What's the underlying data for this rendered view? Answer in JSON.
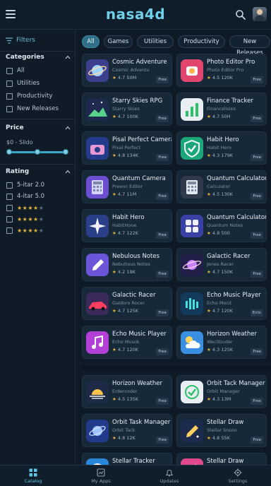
{
  "header": {
    "brand": "nasa4d",
    "menu_icon": "hamburger-icon",
    "search_icon": "search-icon"
  },
  "sidebar": {
    "filters_label": "Filters",
    "categories": {
      "title": "Categories",
      "items": [
        "All",
        "Utilities",
        "Productivity",
        "New Releases"
      ]
    },
    "price": {
      "title": "Price",
      "range_label": "$0 - Slido",
      "range": [
        0,
        1
      ]
    },
    "rating": {
      "title": "Rating",
      "items": [
        {
          "label": "5-itar 2.0",
          "stars": 0
        },
        {
          "label": "4-itar 5.0",
          "stars": 0
        },
        {
          "label": "",
          "stars": 4
        },
        {
          "label": "",
          "stars": 4
        },
        {
          "label": "",
          "stars": 4
        }
      ]
    }
  },
  "chips": [
    "All",
    "Games",
    "Utilities",
    "Productivity",
    "New Releases"
  ],
  "apps": [
    {
      "name": "Cosmic Adventure",
      "sub": "Cosmic Adventu",
      "rating": "4.7",
      "count": "50M",
      "badge": "Free",
      "icon": "planet-icon",
      "icon_color": "#3b3f8c",
      "icon_accent": "#9fd4ff"
    },
    {
      "name": "Photo Editor Pro",
      "sub": "Photo Editor Pro",
      "rating": "4.5",
      "count": "120K",
      "badge": "Free",
      "icon": "photo-editor-icon",
      "icon_color": "#e2466e",
      "icon_accent": "#ffb24a"
    },
    {
      "name": "Starry Skies RPG",
      "sub": "Starry Skies",
      "rating": "4.7",
      "count": "100K",
      "badge": "Free",
      "icon": "starry-sky-icon",
      "icon_color": "#1d2a4e",
      "icon_accent": "#59d28a"
    },
    {
      "name": "Finance Tracker",
      "sub": "Financelisies",
      "rating": "4.7",
      "count": "50H",
      "badge": "Free",
      "icon": "finance-chart-icon",
      "icon_color": "#e9eef2",
      "icon_accent": "#2fbf6a"
    },
    {
      "name": "Pisal Perfect Camera",
      "sub": "Pixal Perfect",
      "rating": "4.8",
      "count": "134K",
      "badge": "Free",
      "icon": "camera-icon",
      "icon_color": "#253c8c",
      "icon_accent": "#e79ad2"
    },
    {
      "name": "Habit Hero",
      "sub": "Habit Hero",
      "rating": "4.3",
      "count": "179K",
      "badge": "Free",
      "icon": "shield-check-icon",
      "icon_color": "#1aa77a",
      "icon_accent": "#ffffff"
    },
    {
      "name": "Quantum  Camera",
      "sub": "Preenc Editor",
      "rating": "4.7",
      "count": "11M",
      "badge": "Free",
      "icon": "calculator-icon",
      "icon_color": "#6b4fd0",
      "icon_accent": "#d8d2ff"
    },
    {
      "name": "Quantum Calculator",
      "sub": "Calculator",
      "rating": "4.5",
      "count": "130K",
      "badge": "Free",
      "icon": "calculator-icon",
      "icon_color": "#2f3a4c",
      "icon_accent": "#e2e9f0"
    },
    {
      "name": "Habit Hero",
      "sub": "HabitHone",
      "rating": "4.7",
      "count": "122K",
      "badge": "Free",
      "icon": "sparkle-icon",
      "icon_color": "#2b3f88",
      "icon_accent": "#f2f2ff"
    },
    {
      "name": "Quantum Calculator",
      "sub": "Quantum Notes",
      "rating": "4.8",
      "count": "500",
      "badge": "Free",
      "icon": "grid-calculator-icon",
      "icon_color": "#3a3fa6",
      "icon_accent": "#f0f2ff"
    },
    {
      "name": "Nebulous Notes",
      "sub": "Nebutious Notes",
      "rating": "4.2",
      "count": "19K",
      "badge": "Free",
      "icon": "pencil-icon",
      "icon_color": "#6c55d8",
      "icon_accent": "#ffffff"
    },
    {
      "name": "Galactic Racer",
      "sub": "Jenes Racer",
      "rating": "4.7",
      "count": "150K",
      "badge": "Free",
      "icon": "saturn-icon",
      "icon_color": "#221f4a",
      "icon_accent": "#c882ff"
    },
    {
      "name": "Galactic Racer",
      "sub": "Galdoro Rocer",
      "rating": "4.7",
      "count": "125K",
      "badge": "Free",
      "icon": "race-car-icon",
      "icon_color": "#3a2a5a",
      "icon_accent": "#ff3e5e"
    },
    {
      "name": "Echo Music Player",
      "sub": "Echo Mocit",
      "rating": "4.7",
      "count": "120K",
      "badge": "Ento",
      "icon": "sound-wave-icon",
      "icon_color": "#123a5a",
      "icon_accent": "#47e0e0"
    },
    {
      "name": "Echo Music Player",
      "sub": "Echo Musok",
      "rating": "4.7",
      "count": "120K",
      "badge": "Free",
      "icon": "music-note-icon",
      "icon_color": "#b23fd6",
      "icon_accent": "#ffffff"
    },
    {
      "name": "Horizon Weather",
      "sub": "Weclitiuder",
      "rating": "4.3",
      "count": "125K",
      "badge": "Free",
      "icon": "weather-sun-cloud-icon",
      "icon_color": "#3a8fe0",
      "icon_accent": "#ffd45a"
    },
    {
      "name": "Horizon Weather",
      "sub": "Erdercoder",
      "rating": "4.5",
      "count": "135K",
      "badge": "Free",
      "icon": "sunrise-icon",
      "icon_color": "#1c2a44",
      "icon_accent": "#ffc24a"
    },
    {
      "name": "Orbit Tack Manager",
      "sub": "Orbit Manager",
      "rating": "4.3",
      "count": "13M",
      "badge": "Free",
      "icon": "check-circle-icon",
      "icon_color": "#e9eef2",
      "icon_accent": "#2fbf6a"
    },
    {
      "name": "Orbit Task Manager",
      "sub": "Orbit Tack",
      "rating": "4.8",
      "count": "12K",
      "badge": "Free",
      "icon": "orbit-planet-icon",
      "icon_color": "#223a8c",
      "icon_accent": "#9fc4ff"
    },
    {
      "name": "Stellar Draw",
      "sub": "Stellar Snsoo",
      "rating": "4.8",
      "count": "55K",
      "badge": "Free",
      "icon": "draw-pencil-icon",
      "icon_color": "#1c2a4e",
      "icon_accent": "#ffd060"
    },
    {
      "name": "Stellar Tracker",
      "sub": "",
      "rating": "",
      "count": "",
      "badge": "",
      "icon": "tracker-icon",
      "icon_color": "#2a86d8",
      "icon_accent": "#ffffff"
    },
    {
      "name": "Stellar Draw",
      "sub": "",
      "rating": "",
      "count": "",
      "badge": "",
      "icon": "draw-pencil-icon",
      "icon_color": "#e04a8a",
      "icon_accent": "#ffffff"
    }
  ],
  "bottom_nav": [
    {
      "label": "Catalog",
      "icon": "catalog-grid-icon",
      "active": true
    },
    {
      "label": "My Apps",
      "icon": "my-apps-icon",
      "active": false
    },
    {
      "label": "Updates",
      "icon": "bell-icon",
      "active": false
    },
    {
      "label": "Settings",
      "icon": "gear-icon",
      "active": false
    }
  ]
}
